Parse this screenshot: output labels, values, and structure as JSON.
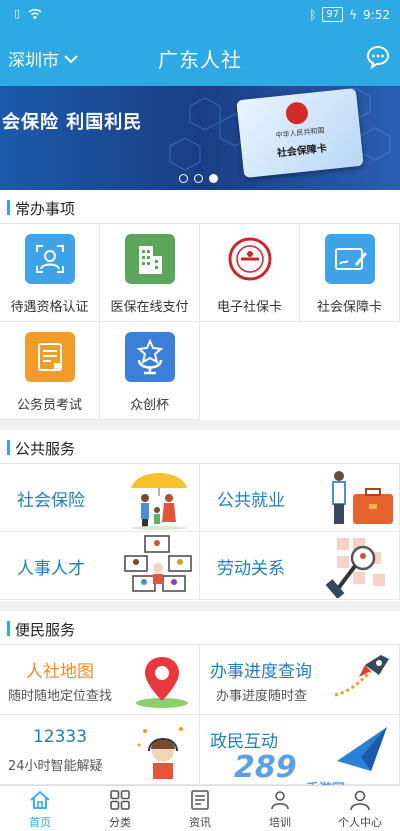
{
  "status_bar": {
    "time": "9:52",
    "battery": "97"
  },
  "header": {
    "city": "深圳市",
    "title": "广东人社"
  },
  "banner": {
    "text": "会保险 利国利民",
    "card_line1": "中华人民共和国",
    "card_line2": "社会保障卡",
    "active_dot": 3
  },
  "sections": {
    "common": "常办事项",
    "public": "公共服务",
    "convenience": "便民服务"
  },
  "common_items": [
    {
      "label": "待遇资格认证",
      "icon": "face-scan-icon",
      "color": "#3fa3e8"
    },
    {
      "label": "医保在线支付",
      "icon": "building-icon",
      "color": "#5aa65a"
    },
    {
      "label": "电子社保卡",
      "icon": "social-security-emblem-icon",
      "color": "#c8282d"
    },
    {
      "label": "社会保障卡",
      "icon": "card-edit-icon",
      "color": "#3fa3e8"
    },
    {
      "label": "公务员考试",
      "icon": "exam-certificate-icon",
      "color": "#f29b26"
    },
    {
      "label": "众创杯",
      "icon": "cup-icon",
      "color": "#3c7fd8"
    }
  ],
  "public_items": [
    {
      "label": "社会保险"
    },
    {
      "label": "公共就业"
    },
    {
      "label": "人事人才"
    },
    {
      "label": "劳动关系"
    }
  ],
  "convenience_items": [
    {
      "title": "人社地图",
      "subtitle": "随时随地定位查找",
      "color": "#f08a2c"
    },
    {
      "title": "办事进度查询",
      "subtitle": "办事进度随时查",
      "color": "#1f7fb4"
    },
    {
      "title": "12333",
      "subtitle": "24小时智能解疑",
      "color": "#1f7fb4"
    },
    {
      "title": "政民互动",
      "subtitle": "",
      "color": "#1f7fb4"
    }
  ],
  "tabs": [
    {
      "label": "首页",
      "icon": "home-icon",
      "active": true
    },
    {
      "label": "分类",
      "icon": "grid-icon",
      "active": false
    },
    {
      "label": "资讯",
      "icon": "news-icon",
      "active": false
    },
    {
      "label": "培训",
      "icon": "training-icon",
      "active": false
    },
    {
      "label": "个人中心",
      "icon": "user-icon",
      "active": false
    }
  ],
  "watermark": {
    "number": "289",
    "text": "手游网"
  },
  "colors": {
    "brand": "#2ea9e3",
    "link": "#1f7fb4"
  }
}
